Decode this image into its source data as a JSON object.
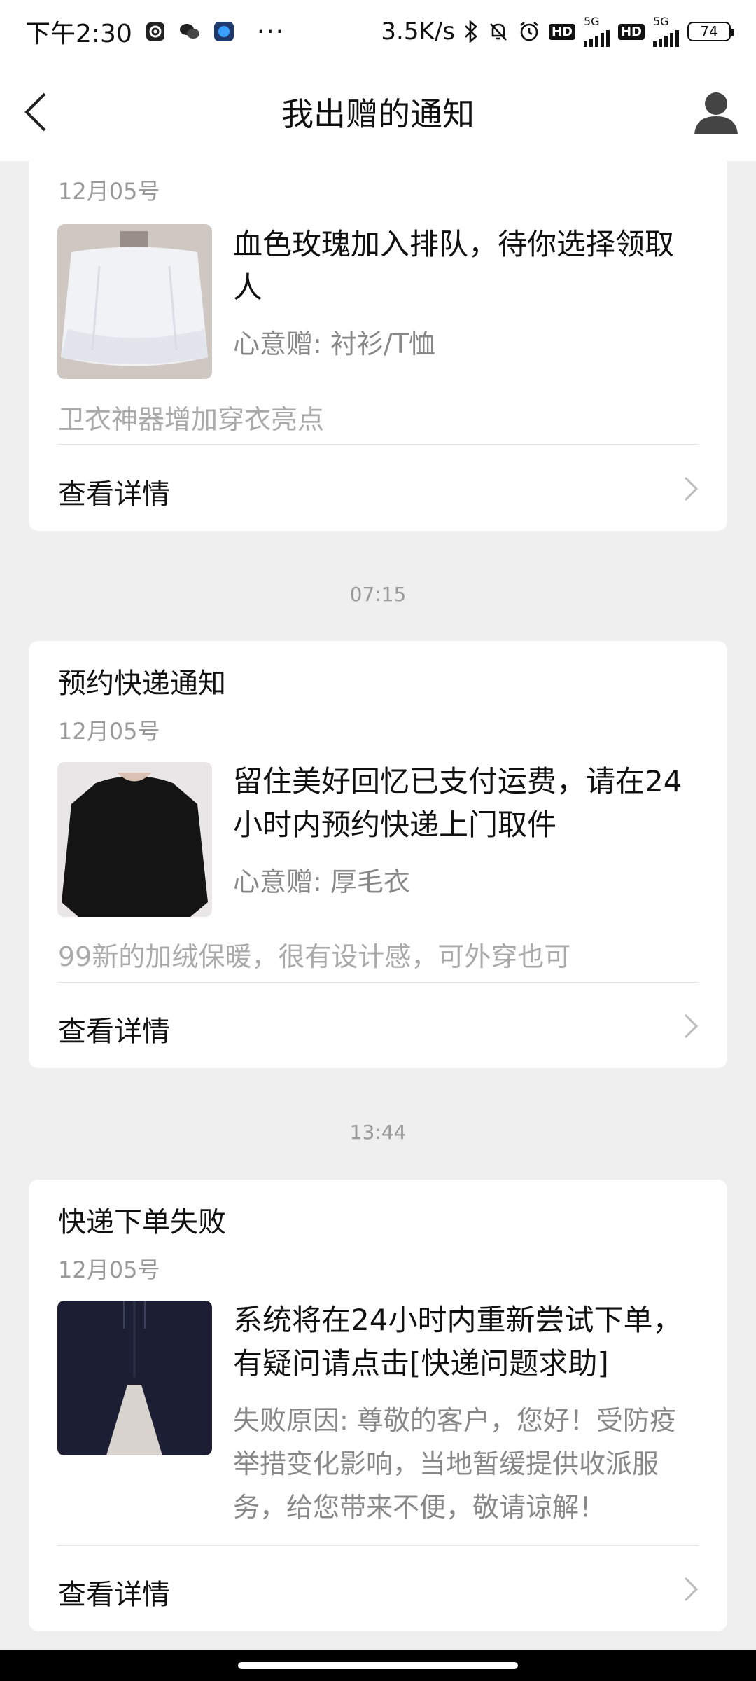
{
  "status_bar": {
    "time": "下午2:30",
    "dots": "···",
    "net_speed": "3.5K/s",
    "network1": "5G",
    "network2": "5G",
    "hd": "HD",
    "battery": "74"
  },
  "header": {
    "title": "我出赠的通知"
  },
  "cards": [
    {
      "title": "",
      "date": "12月05号",
      "message": "血色玫瑰加入排队，待你选择领取人",
      "sub_label": "心意赠: 衬衫/T恤",
      "description": "卫衣神器增加穿衣亮点",
      "detail_label": "查看详情"
    },
    {
      "timestamp": "07:15",
      "title": "预约快递通知",
      "date": "12月05号",
      "message": "留住美好回忆已支付运费，请在24小时内预约快递上门取件",
      "sub_label": "心意赠: 厚毛衣",
      "description": "99新的加绒保暖，很有设计感，可外穿也可",
      "detail_label": "查看详情"
    },
    {
      "timestamp": "13:44",
      "title": "快递下单失败",
      "date": "12月05号",
      "message": "系统将在24小时内重新尝试下单，有疑问请点击[快递问题求助]",
      "sub_label": "失败原因: 尊敬的客户，您好！受防疫举措变化影响，当地暂缓提供收派服务，给您带来不便，敬请谅解！",
      "detail_label": "查看详情"
    }
  ],
  "icons": [
    "settings-icon",
    "wechat-icon",
    "app-icon",
    "bluetooth-icon",
    "mute-icon",
    "alarm-icon",
    "back-arrow-icon",
    "user-avatar-icon",
    "chevron-right-icon"
  ]
}
